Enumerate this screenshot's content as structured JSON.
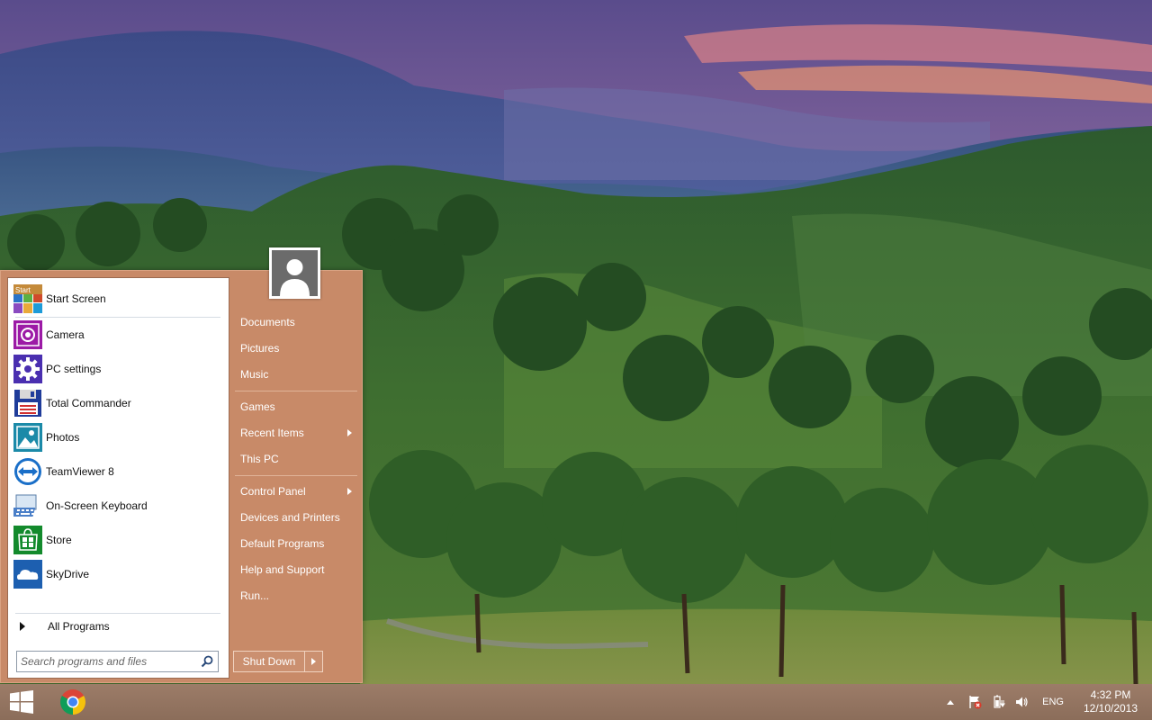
{
  "start_menu": {
    "pinned": [
      {
        "label": "Start Screen",
        "icon": "start-screen-icon"
      },
      {
        "label": "Camera",
        "icon": "camera-icon"
      },
      {
        "label": "PC settings",
        "icon": "gear-icon"
      },
      {
        "label": "Total Commander",
        "icon": "floppy-disk-icon"
      },
      {
        "label": "Photos",
        "icon": "photos-icon"
      },
      {
        "label": "TeamViewer 8",
        "icon": "teamviewer-icon"
      },
      {
        "label": "On-Screen Keyboard",
        "icon": "keyboard-icon"
      },
      {
        "label": "Store",
        "icon": "store-icon"
      },
      {
        "label": "SkyDrive",
        "icon": "cloud-icon"
      }
    ],
    "start_icon_text": "Start",
    "all_programs": "All Programs",
    "search_placeholder": "Search programs and files",
    "places": [
      {
        "label": "Documents"
      },
      {
        "label": "Pictures"
      },
      {
        "label": "Music"
      },
      {
        "label": "Games"
      },
      {
        "label": "Recent Items",
        "submenu": true
      },
      {
        "label": "This PC"
      },
      {
        "label": "Control Panel",
        "submenu": true
      },
      {
        "label": "Devices and Printers"
      },
      {
        "label": "Default Programs"
      },
      {
        "label": "Help and Support"
      },
      {
        "label": "Run..."
      }
    ],
    "shutdown_label": "Shut Down",
    "accent_color": "#c88a68"
  },
  "taskbar": {
    "language": "ENG",
    "time": "4:32 PM",
    "date": "12/10/2013",
    "color": "#957664"
  }
}
